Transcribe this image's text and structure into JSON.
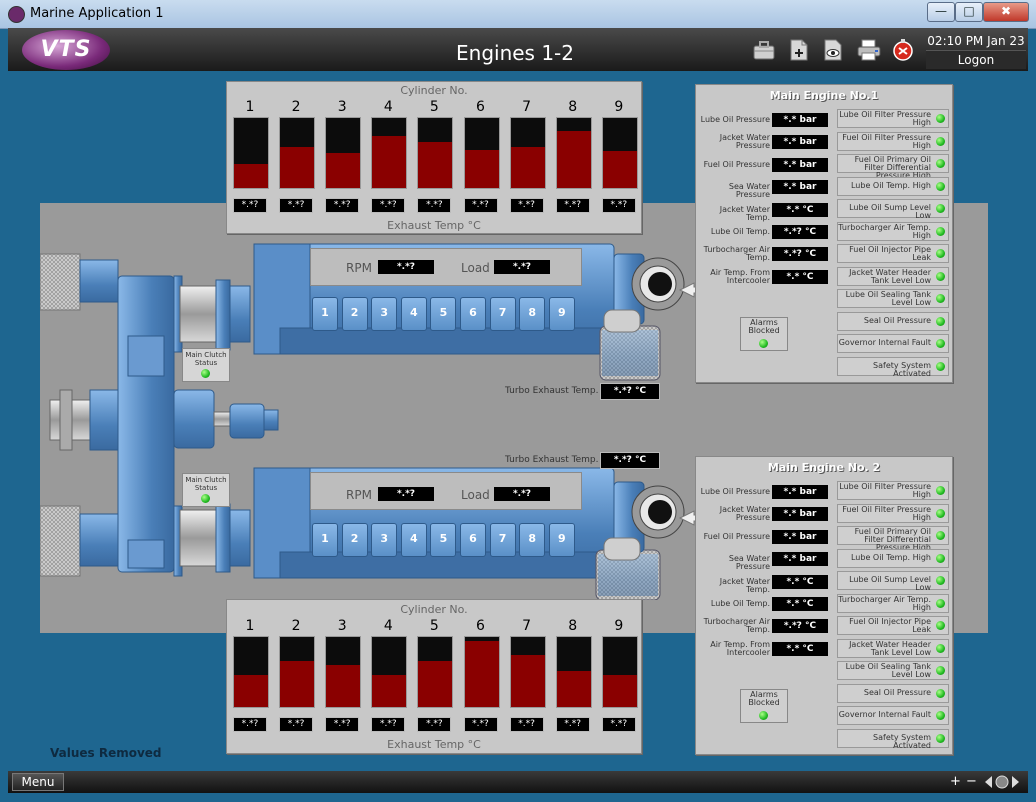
{
  "window": {
    "title": "Marine Application 1",
    "controls": {
      "minimize": "—",
      "maximize": "□",
      "close": "✖"
    }
  },
  "header": {
    "logo_text": "VTS",
    "title": "Engines 1-2",
    "icons": [
      "briefcase-icon",
      "add-document-icon",
      "view-document-icon",
      "print-icon",
      "alarm-off-icon"
    ],
    "clock": "02:10 PM Jan 23",
    "logon": "Logon"
  },
  "cylinder_panels": [
    {
      "title": "Cylinder  No.",
      "numbers": [
        "1",
        "2",
        "3",
        "4",
        "5",
        "6",
        "7",
        "8",
        "9"
      ],
      "levels": [
        0.34,
        0.58,
        0.5,
        0.74,
        0.65,
        0.54,
        0.59,
        0.82,
        0.53
      ],
      "values": [
        "*.*?",
        "*.*?",
        "*.*?",
        "*.*?",
        "*.*?",
        "*.*?",
        "*.*?",
        "*.*?",
        "*.*?"
      ],
      "footer": "Exhaust Temp °C"
    },
    {
      "title": "Cylinder  No.",
      "numbers": [
        "1",
        "2",
        "3",
        "4",
        "5",
        "6",
        "7",
        "8",
        "9"
      ],
      "levels": [
        0.45,
        0.66,
        0.6,
        0.45,
        0.65,
        0.94,
        0.74,
        0.52,
        0.45
      ],
      "values": [
        "*.*?",
        "*.*?",
        "*.*?",
        "*.*?",
        "*.*?",
        "*.*?",
        "*.*?",
        "*.*?",
        "*.*?"
      ],
      "footer": "Exhaust Temp °C"
    }
  ],
  "engines": [
    {
      "title": "Main Engine No.1",
      "readings": [
        {
          "label": "Lube Oil Pressure",
          "value": "*.* bar"
        },
        {
          "label": "Jacket Water Pressure",
          "value": "*.* bar"
        },
        {
          "label": "Fuel Oil Pressure",
          "value": "*.* bar"
        },
        {
          "label": "Sea Water Pressure",
          "value": "*.* bar"
        },
        {
          "label": "Jacket Water Temp.",
          "value": "*.* °C"
        },
        {
          "label": "Lube Oil Temp.",
          "value": "*.*? °C"
        },
        {
          "label": "Turbocharger Air Temp.",
          "value": "*.*? °C"
        },
        {
          "label": "Air Temp. From Intercooler",
          "value": "*.* °C"
        }
      ],
      "alarms": [
        "Lube Oil Filter Pressure High",
        "Fuel Oil Filter Pressure High",
        "Fuel Oil Primary Oil Filter Differential Pressure High",
        "Lube Oil Temp. High",
        "Lube Oil Sump Level Low",
        "Turbocharger Air Temp. High",
        "Fuel Oil Injector Pipe Leak",
        "Jacket Water Header Tank Level Low",
        "Lube Oil Sealing Tank Level Low",
        "Seal Oil Pressure",
        "Governor Internal Fault",
        "Safety System Activated"
      ],
      "alarms_blocked": "Alarms Blocked",
      "rpm_label": "RPM",
      "rpm_value": "*.*?",
      "load_label": "Load",
      "load_value": "*.*?",
      "clutch_label": "Main Clutch Status",
      "turbo_label": "Turbo Exhaust Temp.",
      "turbo_value": "*.*? °C",
      "cylinder_tiles": [
        "1",
        "2",
        "3",
        "4",
        "5",
        "6",
        "7",
        "8",
        "9"
      ]
    },
    {
      "title": "Main Engine No. 2",
      "readings": [
        {
          "label": "Lube Oil Pressure",
          "value": "*.* bar"
        },
        {
          "label": "Jacket Water Pressure",
          "value": "*.* bar"
        },
        {
          "label": "Fuel Oil Pressure",
          "value": "*.* bar"
        },
        {
          "label": "Sea Water Pressure",
          "value": "*.* bar"
        },
        {
          "label": "Jacket Water Temp.",
          "value": "*.* °C"
        },
        {
          "label": "Lube Oil Temp.",
          "value": "*.* °C"
        },
        {
          "label": "Turbocharger Air Temp.",
          "value": "*.*? °C"
        },
        {
          "label": "Air Temp. From Intercooler",
          "value": "*.* °C"
        }
      ],
      "alarms": [
        "Lube Oil Filter Pressure High",
        "Fuel Oil Filter Pressure High",
        "Fuel Oil Primary Oil Filter Differential Pressure High",
        "Lube Oil Temp. High",
        "Lube Oil Sump Level Low",
        "Turbocharger Air Temp. High",
        "Fuel Oil Injector Pipe Leak",
        "Jacket Water Header Tank Level Low",
        "Lube Oil Sealing Tank Level Low",
        "Seal Oil Pressure",
        "Governor Internal Fault",
        "Safety System Activated"
      ],
      "alarms_blocked": "Alarms Blocked",
      "rpm_label": "RPM",
      "rpm_value": "*.*?",
      "load_label": "Load",
      "load_value": "*.*?",
      "clutch_label": "Main Clutch Status",
      "turbo_label": "Turbo Exhaust Temp.",
      "turbo_value": "*.*? °C",
      "cylinder_tiles": [
        "1",
        "2",
        "3",
        "4",
        "5",
        "6",
        "7",
        "8",
        "9"
      ]
    }
  ],
  "footer": {
    "note": "Values Removed",
    "menu": "Menu",
    "zoom_in": "+",
    "zoom_out": "−",
    "nav_icons": [
      "zoom-in-icon",
      "zoom-out-icon",
      "navigation-icon"
    ]
  },
  "colors": {
    "background": "#1e6690",
    "cylinder_fill": "#8a0000",
    "engine_blue": "#4a7fb8",
    "led_ok": "#22bb22"
  }
}
